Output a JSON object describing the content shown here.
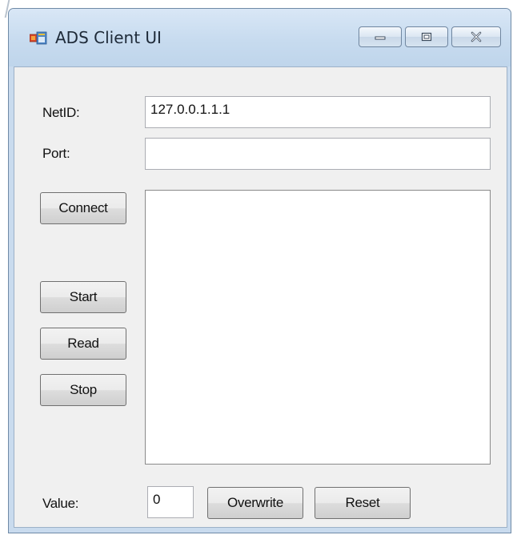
{
  "window": {
    "title": "ADS Client UI",
    "icons": {
      "app": "windows-app-icon",
      "minimize": "minimize-icon",
      "maximize": "maximize-icon",
      "close": "close-icon"
    }
  },
  "form": {
    "netid_label": "NetID:",
    "netid_value": "127.0.0.1.1.1",
    "port_label": "Port:",
    "port_value": "",
    "connect_label": "Connect",
    "start_label": "Start",
    "read_label": "Read",
    "stop_label": "Stop",
    "output_text": "",
    "value_label": "Value:",
    "value_value": "0",
    "overwrite_label": "Overwrite",
    "reset_label": "Reset"
  },
  "colors": {
    "title_bar": "#c7dbef",
    "client_background": "#f0f0f0",
    "button_face": "#e5e5e5"
  }
}
